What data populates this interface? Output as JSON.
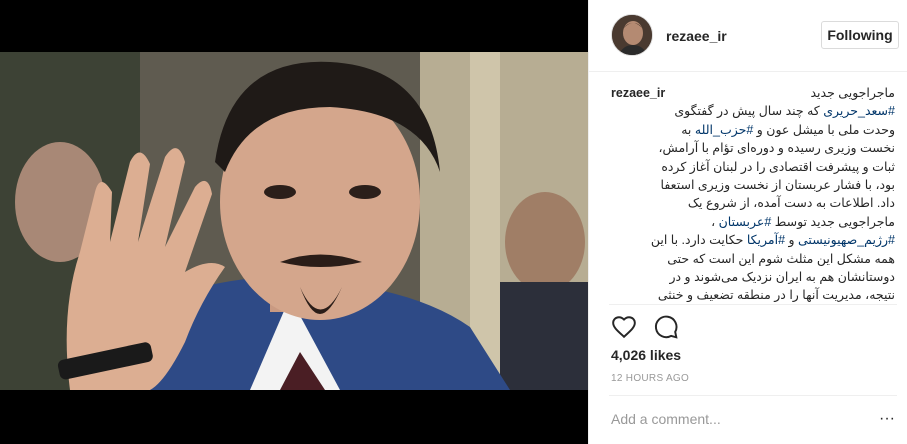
{
  "post": {
    "username": "rezaee_ir",
    "follow_label": "Following",
    "caption_lines": [
      "ماجراجویی جدید",
      "#سعد_حریری که چند سال پیش در گفتگوی",
      "وحدت ملی با میشل عون و #حزب_الله به",
      "نخست وزیری رسیده و دوره‌ای تؤام با آرامش،",
      "ثبات و پیشرفت اقتصادی را در لبنان آغاز کرده",
      "بود، با فشار عربستان از نخست وزیری استعفا",
      "داد. اطلاعات به دست آمده، از شروع یک",
      "ماجراجویی جدید توسط #عربستان ،",
      "#رژیم_صهیونیستی و #آمریکا حکایت دارد. با این",
      "همه مشکل این مثلث شوم این است که حتی",
      "دوستانشان هم به ایران نزدیک می‌شوند و در",
      "نتیجه، مدیریت آنها را در منطقه تضعیف و خنثی"
    ],
    "likes": "4,026 likes",
    "timestamp": "12 HOURS AGO",
    "comment_placeholder": "Add a comment...",
    "more_label": "···"
  },
  "icons": {
    "like": "heart-icon",
    "comment": "comment-icon",
    "more": "more-options-icon"
  },
  "colors": {
    "hashtag": "#003569",
    "border": "#efefef",
    "muted": "#999999"
  }
}
